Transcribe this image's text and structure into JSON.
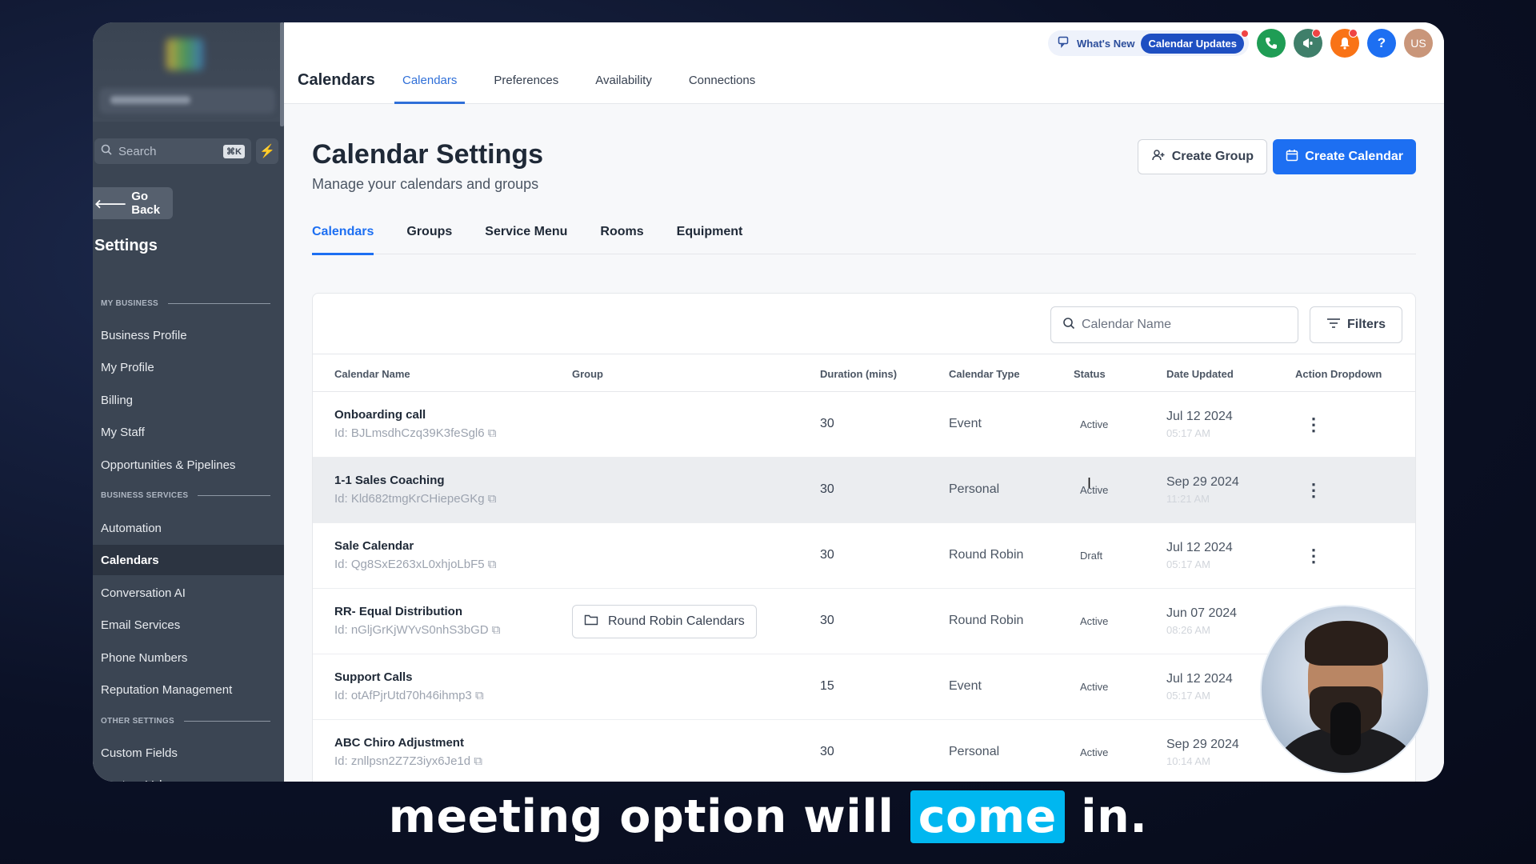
{
  "sidebar": {
    "search_placeholder": "Search",
    "search_shortcut": "⌘K",
    "go_back": "Go Back",
    "title": "Settings",
    "sections": [
      {
        "label": "MY BUSINESS",
        "items": [
          "Business Profile",
          "My Profile",
          "Billing",
          "My Staff",
          "Opportunities & Pipelines"
        ]
      },
      {
        "label": "BUSINESS SERVICES",
        "items": [
          "Automation",
          "Calendars",
          "Conversation AI",
          "Email Services",
          "Phone Numbers",
          "Reputation Management"
        ]
      },
      {
        "label": "OTHER SETTINGS",
        "items": [
          "Custom Fields",
          "Custom Values"
        ]
      }
    ],
    "active_item": "Calendars"
  },
  "topbar": {
    "page_name": "Calendars",
    "nav": [
      "Calendars",
      "Preferences",
      "Availability",
      "Connections"
    ],
    "active_nav": "Calendars",
    "whats_new": "What's New",
    "calendar_updates": "Calendar Updates",
    "help_label": "?",
    "avatar_initials": "US"
  },
  "page": {
    "title": "Calendar Settings",
    "subtitle": "Manage your calendars and groups",
    "create_group": "Create Group",
    "create_calendar": "Create Calendar",
    "tabs": [
      "Calendars",
      "Groups",
      "Service Menu",
      "Rooms",
      "Equipment"
    ],
    "active_tab": "Calendars"
  },
  "table": {
    "search_placeholder": "Calendar Name",
    "filters": "Filters",
    "columns": [
      "Calendar Name",
      "Group",
      "Duration (mins)",
      "Calendar Type",
      "Status",
      "Date Updated",
      "Action Dropdown"
    ],
    "rows": [
      {
        "name": "Onboarding call",
        "id": "Id: BJLmsdhCzq39K3feSgl6",
        "group": "",
        "duration": "30",
        "type": "Event",
        "status": "Active",
        "date": "Jul 12 2024",
        "time": "05:17 AM"
      },
      {
        "name": "1-1 Sales Coaching",
        "id": "Id: Kld682tmgKrCHiepeGKg",
        "group": "",
        "duration": "30",
        "type": "Personal",
        "status": "Active",
        "date": "Sep 29 2024",
        "time": "11:21 AM"
      },
      {
        "name": "Sale Calendar",
        "id": "Id: Qg8SxE263xL0xhjoLbF5",
        "group": "",
        "duration": "30",
        "type": "Round Robin",
        "status": "Draft",
        "date": "Jul 12 2024",
        "time": "05:17 AM"
      },
      {
        "name": "RR- Equal Distribution",
        "id": "Id: nGljGrKjWYvS0nhS3bGD",
        "group": "Round Robin Calendars",
        "duration": "30",
        "type": "Round Robin",
        "status": "Active",
        "date": "Jun 07 2024",
        "time": "08:26 AM"
      },
      {
        "name": "Support Calls",
        "id": "Id: otAfPjrUtd70h46ihmp3",
        "group": "",
        "duration": "15",
        "type": "Event",
        "status": "Active",
        "date": "Jul 12 2024",
        "time": "05:17 AM"
      },
      {
        "name": "ABC Chiro Adjustment",
        "id": "Id: znllpsn2Z7Z3iyx6Je1d",
        "group": "",
        "duration": "30",
        "type": "Personal",
        "status": "Active",
        "date": "Sep 29 2024",
        "time": "10:14 AM"
      }
    ]
  },
  "caption": {
    "before": "meeting option will",
    "highlight": "come",
    "after": "in."
  },
  "colors": {
    "accent": "#1d6ff2",
    "sidebar_bg": "#3b4553",
    "caption_highlight": "#00b7f0"
  }
}
